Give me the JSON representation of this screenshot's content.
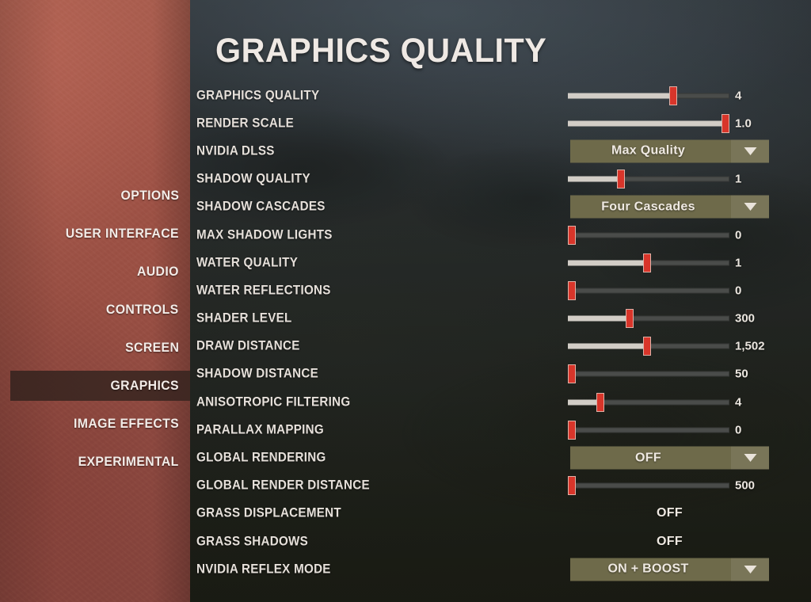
{
  "sidebar": {
    "items": [
      {
        "label": "OPTIONS",
        "active": false
      },
      {
        "label": "USER INTERFACE",
        "active": false
      },
      {
        "label": "AUDIO",
        "active": false
      },
      {
        "label": "CONTROLS",
        "active": false
      },
      {
        "label": "SCREEN",
        "active": false
      },
      {
        "label": "GRAPHICS",
        "active": true
      },
      {
        "label": "IMAGE EFFECTS",
        "active": false
      },
      {
        "label": "EXPERIMENTAL",
        "active": false
      }
    ]
  },
  "main": {
    "title": "GRAPHICS QUALITY",
    "rows": [
      {
        "label": "GRAPHICS QUALITY",
        "control": "slider",
        "value": "4",
        "percent": 65
      },
      {
        "label": "RENDER SCALE",
        "control": "slider",
        "value": "1.0",
        "percent": 100
      },
      {
        "label": "NVIDIA DLSS",
        "control": "dropdown",
        "value": "Max Quality"
      },
      {
        "label": "SHADOW QUALITY",
        "control": "slider",
        "value": "1",
        "percent": 33
      },
      {
        "label": "SHADOW CASCADES",
        "control": "dropdown",
        "value": "Four Cascades"
      },
      {
        "label": "MAX SHADOW LIGHTS",
        "control": "slider",
        "value": "0",
        "percent": 0
      },
      {
        "label": "WATER QUALITY",
        "control": "slider",
        "value": "1",
        "percent": 49
      },
      {
        "label": "WATER REFLECTIONS",
        "control": "slider",
        "value": "0",
        "percent": 0
      },
      {
        "label": "SHADER LEVEL",
        "control": "slider",
        "value": "300",
        "percent": 38
      },
      {
        "label": "DRAW DISTANCE",
        "control": "slider",
        "value": "1,502",
        "percent": 49
      },
      {
        "label": "SHADOW DISTANCE",
        "control": "slider",
        "value": "50",
        "percent": 0
      },
      {
        "label": "ANISOTROPIC FILTERING",
        "control": "slider",
        "value": "4",
        "percent": 20
      },
      {
        "label": "PARALLAX MAPPING",
        "control": "slider",
        "value": "0",
        "percent": 0
      },
      {
        "label": "GLOBAL RENDERING",
        "control": "dropdown",
        "value": "OFF"
      },
      {
        "label": "GLOBAL RENDER DISTANCE",
        "control": "slider",
        "value": "500",
        "percent": 0
      },
      {
        "label": "GRASS DISPLACEMENT",
        "control": "text",
        "value": "OFF"
      },
      {
        "label": "GRASS SHADOWS",
        "control": "text",
        "value": "OFF"
      },
      {
        "label": "NVIDIA REFLEX MODE",
        "control": "dropdown",
        "value": "ON + BOOST"
      }
    ]
  },
  "colors": {
    "accent_red": "#d8352a",
    "dropdown_olive": "#6e6a4a",
    "sidebar_red": "#9a5044",
    "panel_dark": "#2b3031",
    "text_light": "#e6e0da"
  }
}
